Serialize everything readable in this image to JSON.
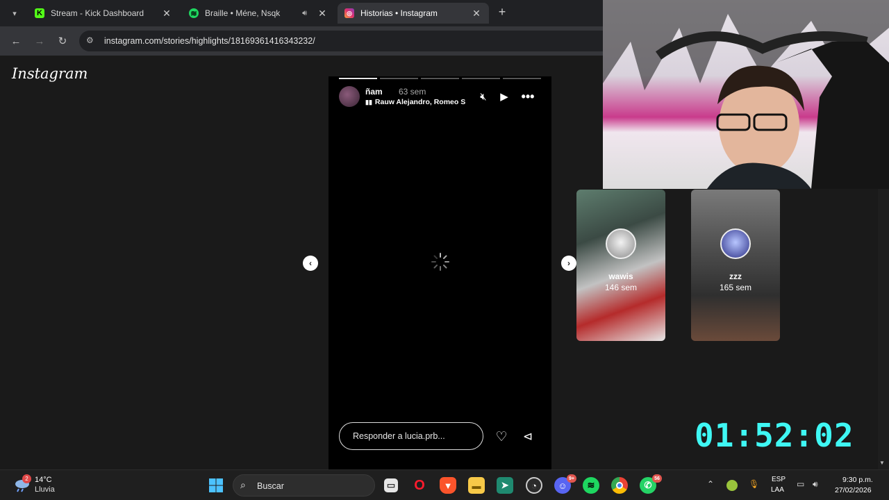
{
  "browser": {
    "tabs": [
      {
        "title": "Stream - Kick Dashboard",
        "favicon": "kick-icon",
        "color": "#53fc18"
      },
      {
        "title": "Braille • Méne, Nsqk",
        "favicon": "spotify-icon",
        "color": "#1ed760"
      },
      {
        "title": "Historias • Instagram",
        "favicon": "instagram-icon",
        "color": "#e1306c"
      }
    ],
    "url": "instagram.com/stories/highlights/18169361416343232/"
  },
  "page": {
    "logo": "Instagram",
    "story": {
      "username": "ñam",
      "age": "63 sem",
      "music": "Rauw Alejandro, Romeo S",
      "progress_segments": 5,
      "progress_completed": 1,
      "reply_placeholder": "Responder a lucia.prb..."
    },
    "next_highlights": [
      {
        "name": "wawis",
        "age": "146 sem"
      },
      {
        "name": "zzz",
        "age": "165 sem"
      }
    ]
  },
  "overlay": {
    "timer": "01:52:02"
  },
  "taskbar": {
    "weather_temp": "14°C",
    "weather_desc": "Lluvia",
    "weather_badge": "2",
    "search_label": "Buscar",
    "discord_badge": "9+",
    "whatsapp_badge": "56",
    "lang_primary": "ESP",
    "lang_secondary": "LAA",
    "time": "9:30 p.m.",
    "date": "27/02/2026"
  }
}
